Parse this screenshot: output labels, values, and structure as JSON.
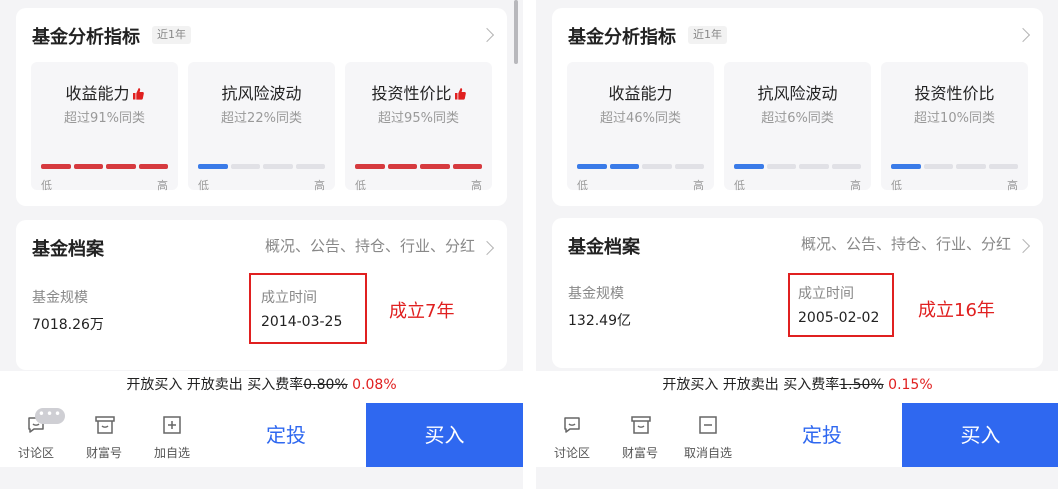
{
  "colors": {
    "accent_blue": "#2f68f0",
    "accent_red": "#e02020",
    "bar_red": "#d63a3f",
    "bar_blue": "#3a7be8",
    "bar_empty": "#e1e1e6"
  },
  "panels": [
    {
      "analysis": {
        "title": "基金分析指标",
        "period_tag": "近1年",
        "metrics": [
          {
            "title": "收益能力",
            "thumb_icon": true,
            "subtitle": "超过91%同类",
            "filled_segments": 4,
            "total_segments": 4,
            "color": "red",
            "low": "低",
            "high": "高"
          },
          {
            "title": "抗风险波动",
            "thumb_icon": false,
            "subtitle": "超过22%同类",
            "filled_segments": 1,
            "total_segments": 4,
            "color": "blue",
            "low": "低",
            "high": "高"
          },
          {
            "title": "投资性价比",
            "thumb_icon": true,
            "subtitle": "超过95%同类",
            "filled_segments": 4,
            "total_segments": 4,
            "color": "red",
            "low": "低",
            "high": "高"
          }
        ]
      },
      "profile": {
        "title": "基金档案",
        "links": "概况、公告、持仓、行业、分红",
        "scale_label": "基金规模",
        "scale_value": "7018.26万",
        "established_label": "成立时间",
        "established_value": "2014-03-25",
        "annotation": "成立7年"
      },
      "fee": {
        "text": "开放买入 开放卖出  买入费率",
        "old_rate": "0.80%",
        "new_rate": "0.08%"
      },
      "toolbar": {
        "discuss_label": "讨论区",
        "discuss_badge": "•••",
        "wealth_label": "财富号",
        "watch_label": "加自选",
        "watch_icon": "plus-square-icon",
        "sip_label": "定投",
        "buy_label": "买入"
      }
    },
    {
      "analysis": {
        "title": "基金分析指标",
        "period_tag": "近1年",
        "metrics": [
          {
            "title": "收益能力",
            "thumb_icon": false,
            "subtitle": "超过46%同类",
            "filled_segments": 2,
            "total_segments": 4,
            "color": "blue",
            "low": "低",
            "high": "高"
          },
          {
            "title": "抗风险波动",
            "thumb_icon": false,
            "subtitle": "超过6%同类",
            "filled_segments": 1,
            "total_segments": 4,
            "color": "blue",
            "low": "低",
            "high": "高"
          },
          {
            "title": "投资性价比",
            "thumb_icon": false,
            "subtitle": "超过10%同类",
            "filled_segments": 1,
            "total_segments": 4,
            "color": "blue",
            "low": "低",
            "high": "高"
          }
        ]
      },
      "profile": {
        "title": "基金档案",
        "links": "概况、公告、持仓、行业、分红",
        "scale_label": "基金规模",
        "scale_value": "132.49亿",
        "established_label": "成立时间",
        "established_value": "2005-02-02",
        "annotation": "成立16年"
      },
      "fee": {
        "text": "开放买入 开放卖出  买入费率",
        "old_rate": "1.50%",
        "new_rate": "0.15%"
      },
      "toolbar": {
        "discuss_label": "讨论区",
        "discuss_badge": "",
        "wealth_label": "财富号",
        "watch_label": "取消自选",
        "watch_icon": "minus-square-icon",
        "sip_label": "定投",
        "buy_label": "买入"
      }
    }
  ]
}
